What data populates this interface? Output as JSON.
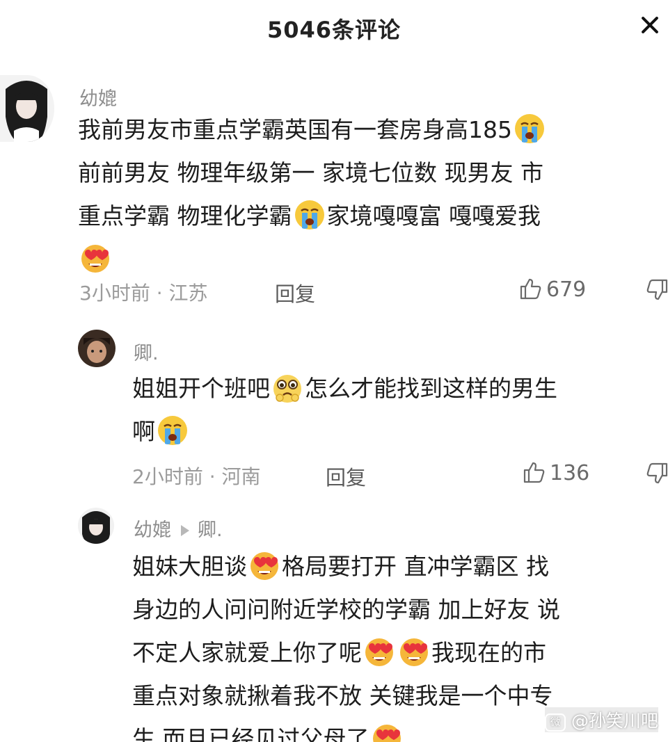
{
  "header": {
    "title": "5046条评论",
    "close_icon": "close-icon"
  },
  "comments": [
    {
      "username": "幼媲",
      "lines": [
        "我前男友市重点学霸英国有一套房身高185",
        "前前男友 物理年级第一 家境七位数 现男友 市",
        "重点学霸 物理化学霸",
        "家境嘎嘎富 嘎嘎爱我"
      ],
      "time": "3小时前 · 江苏",
      "reply_label": "回复",
      "likes": "679"
    },
    {
      "username": "卿.",
      "lines": [
        "姐姐开个班吧",
        "怎么才能找到这样的男生",
        "啊"
      ],
      "time": "2小时前 · 河南",
      "reply_label": "回复",
      "likes": "136"
    },
    {
      "username": "幼媲",
      "reply_to": "卿.",
      "lines": [
        "姐妹大胆谈",
        "格局要打开 直冲学霸区 找",
        "身边的人问问附近学校的学霸 加上好友 说",
        "不定人家就爱上你了呢",
        "我现在的市",
        "重点对象就揪着我不放 关键我是一个中专",
        "生 而且已经见过父母了"
      ]
    }
  ],
  "watermark": {
    "icon": "weibo-icon",
    "text": "@孙笑川吧"
  },
  "icons": [
    "close-icon",
    "thumbs-up-icon",
    "thumbs-down-icon",
    "crying-face-emoji",
    "heart-eyes-emoji",
    "pleading-face-emoji",
    "reply-arrow-icon"
  ]
}
